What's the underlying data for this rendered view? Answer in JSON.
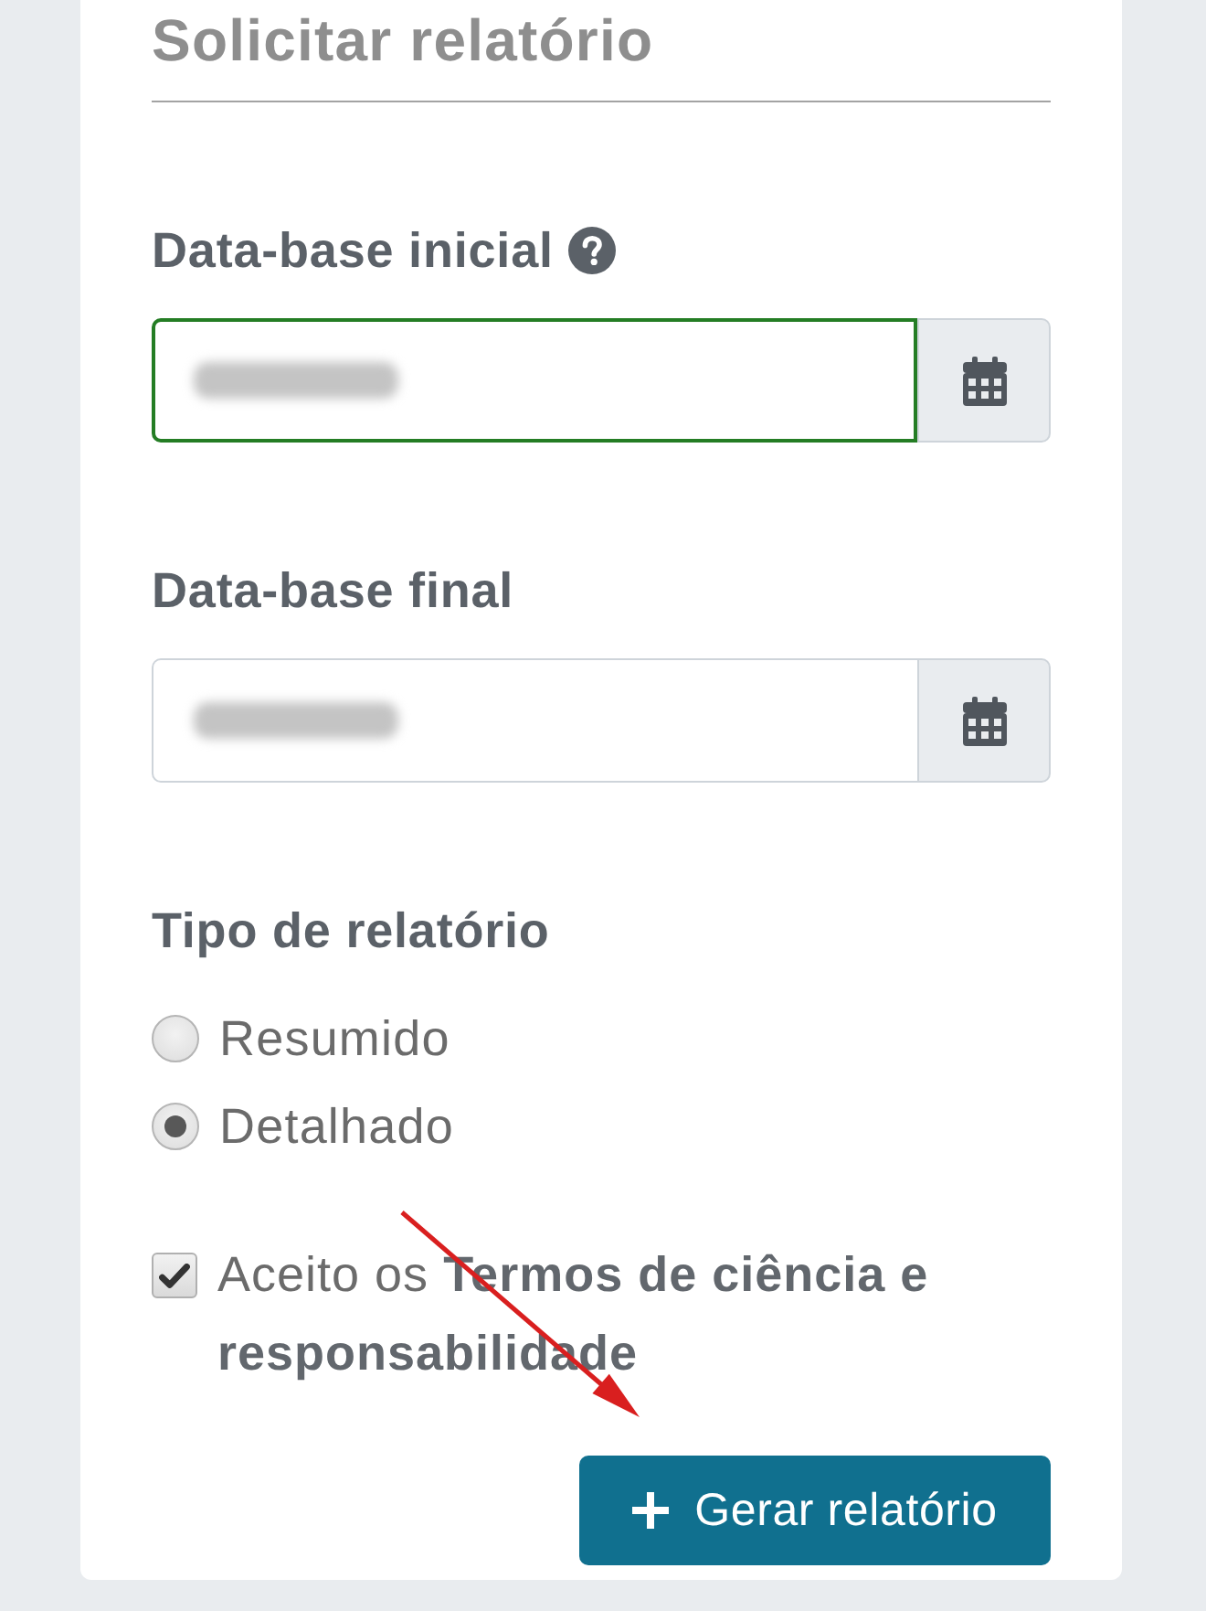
{
  "form": {
    "title": "Solicitar relatório",
    "fields": [
      {
        "label": "Data-base inicial",
        "help": true,
        "focused": true,
        "value_redacted": true
      },
      {
        "label": "Data-base final",
        "help": false,
        "focused": false,
        "value_redacted": true
      }
    ],
    "report_type": {
      "label": "Tipo de relatório",
      "options": [
        {
          "label": "Resumido",
          "selected": false
        },
        {
          "label": "Detalhado",
          "selected": true
        }
      ]
    },
    "terms": {
      "label": "Aceito os **Termos de ciência e responsabilidade**",
      "checked": true
    },
    "submit_button": {
      "label": "Gerar relatório"
    }
  },
  "annotation": {
    "kind": "arrow"
  }
}
